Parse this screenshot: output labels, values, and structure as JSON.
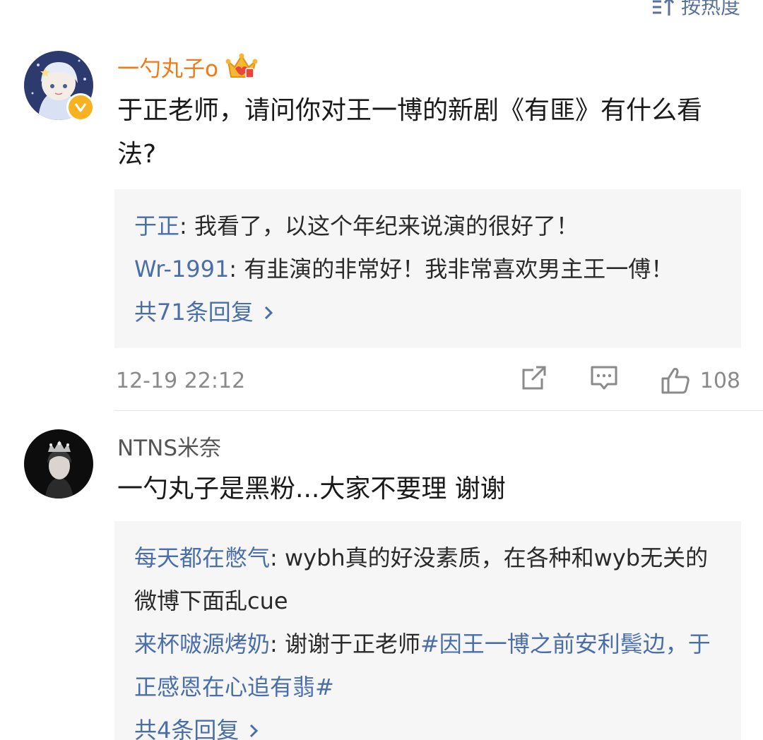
{
  "sort": {
    "label": "按热度",
    "icon": "sort-icon"
  },
  "comments": [
    {
      "username": "一勺丸子o",
      "verified": true,
      "vip_icon": "crown-icon",
      "content": "于正老师，请问你对王一博的新剧《有匪》有什么看法?",
      "replies": [
        {
          "name": "于正",
          "sep": ": ",
          "text": "我看了，以这个年纪来说演的很好了！"
        },
        {
          "name": "Wr-1991",
          "sep": ": ",
          "text": "有韭演的非常好！我非常喜欢男主王一傅！"
        }
      ],
      "more": "共71条回复",
      "timestamp": "12-19 22:12",
      "likes": "108",
      "actions": [
        "share-icon",
        "comment-icon",
        "like-icon"
      ]
    },
    {
      "username": "NTNS米奈",
      "verified": false,
      "content": "一勺丸子是黑粉...大家不要理 谢谢",
      "replies": [
        {
          "name": "每天都在憋气",
          "sep": ": ",
          "text": "wybh真的好没素质，在各种和wyb无关的微博下面乱cue"
        },
        {
          "name": "来杯啵源烤奶",
          "sep": ": ",
          "text": "谢谢于正老师",
          "tag": "#因王一博之前安利鬓边，于正感恩在心追有翡#"
        }
      ],
      "more": "共4条回复"
    }
  ],
  "colors": {
    "link": "#4a6fa8",
    "vip_name": "#f07a16",
    "reply_bg": "#f6f6f7",
    "meta": "#8a8a8a"
  }
}
